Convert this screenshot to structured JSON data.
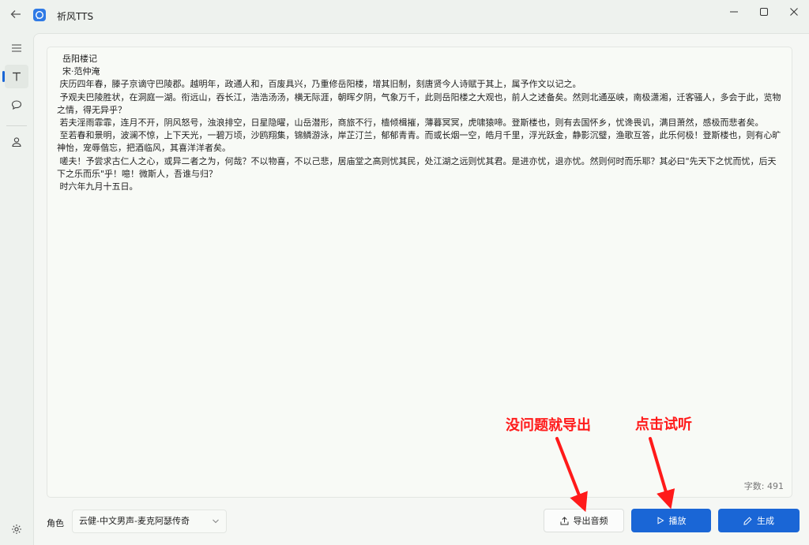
{
  "window": {
    "title": "祈风TTS"
  },
  "nav": {
    "items": [
      "menu-icon",
      "text-icon",
      "chat-icon",
      "user-icon",
      "settings-icon"
    ],
    "active_index": 1
  },
  "editor": {
    "text": "  岳阳楼记\n  宋·范仲淹\n 庆历四年春，滕子京谪守巴陵郡。越明年，政通人和，百废具兴，乃重修岳阳楼，增其旧制，刻唐贤今人诗赋于其上，属予作文以记之。\n 予观夫巴陵胜状，在洞庭一湖。衔远山，吞长江，浩浩汤汤，横无际涯，朝晖夕阴，气象万千，此则岳阳楼之大观也，前人之述备矣。然则北通巫峡，南极潇湘，迁客骚人，多会于此，览物之情，得无异乎？\n 若夫淫雨霏霏，连月不开，阴风怒号，浊浪排空，日星隐曜，山岳潜形，商旅不行，樯倾楫摧，薄暮冥冥，虎啸猿啼。登斯楼也，则有去国怀乡，忧谗畏讥，满目萧然，感极而悲者矣。\n 至若春和景明，波澜不惊，上下天光，一碧万顷，沙鸥翔集，锦鳞游泳，岸芷汀兰，郁郁青青。而或长烟一空，皓月千里，浮光跃金，静影沉璧，渔歌互答，此乐何极！登斯楼也，则有心旷神怡，宠辱偕忘，把酒临风，其喜洋洋者矣。\n 嗟夫！予尝求古仁人之心，或异二者之为，何哉？不以物喜，不以己悲，居庙堂之高则忧其民，处江湖之远则忧其君。是进亦忧，退亦忧。然则何时而乐耶？其必曰\"先天下之忧而忧，后天下之乐而乐\"乎！噫！微斯人，吾谁与归？\n 时六年九月十五日。",
    "char_count": "字数: 491"
  },
  "bottom": {
    "role_label": "角色",
    "role_value": "云健-中文男声-麦克阿瑟传奇",
    "export_label": "导出音频",
    "play_label": "播放",
    "generate_label": "生成"
  },
  "annotations": {
    "export_hint": "没问题就导出",
    "play_hint": "点击试听",
    "color": "#ff1a1a"
  },
  "colors": {
    "accent": "#1a66d6",
    "background": "#eef2ee"
  }
}
